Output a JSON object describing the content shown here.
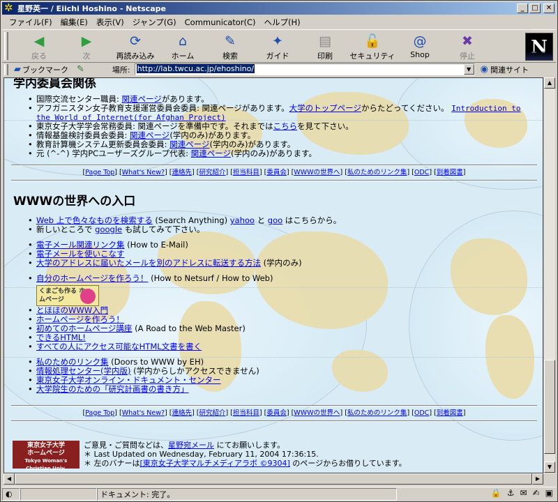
{
  "window": {
    "title": "星野英一 / Eiichi Hoshino - Netscape",
    "controls": {
      "minimize": "_",
      "maximize": "□",
      "close": "✕"
    }
  },
  "menu": [
    "ファイル(F)",
    "編集(E)",
    "表示(V)",
    "ジャンプ(G)",
    "Communicator(C)",
    "ヘルプ(H)"
  ],
  "toolbar": [
    {
      "label": "戻る",
      "icon": "back-arrow-icon",
      "glyph": "◀",
      "disabled": true
    },
    {
      "label": "次",
      "icon": "forward-arrow-icon",
      "glyph": "▶",
      "disabled": true
    },
    {
      "label": "再読み込み",
      "icon": "reload-icon",
      "glyph": "⟳",
      "disabled": false
    },
    {
      "label": "ホーム",
      "icon": "home-icon",
      "glyph": "⌂",
      "disabled": false
    },
    {
      "label": "検索",
      "icon": "search-icon",
      "glyph": "✎",
      "disabled": false
    },
    {
      "label": "ガイド",
      "icon": "guide-icon",
      "glyph": "✦",
      "disabled": false
    },
    {
      "label": "印刷",
      "icon": "print-icon",
      "glyph": "▤",
      "disabled": false
    },
    {
      "label": "セキュリティ",
      "icon": "lock-icon",
      "glyph": "🔓",
      "disabled": false
    },
    {
      "label": "Shop",
      "icon": "shop-icon",
      "glyph": "@",
      "disabled": false
    },
    {
      "label": "停止",
      "icon": "stop-icon",
      "glyph": "✖",
      "disabled": true
    }
  ],
  "brand_letter": "N",
  "location": {
    "bookmark_label": "ブックマーク",
    "location_label": "場所:",
    "url": "http://lab.twcu.ac.jp/ehoshino/",
    "related_label": "関連サイト"
  },
  "content": {
    "section1_title": "学内委員会関係",
    "section1_items": [
      {
        "pre": "国際交流センター職員: ",
        "link": "関連ページ",
        "post": "があります。"
      },
      {
        "pre": "アフガニスタン女子教育支援運営委員会委員: 関連ページがあります。",
        "link": "大学のトップページ",
        "post": "からたどってください。",
        "link2": "Introduction to the World of Internet(for Afghan Project)"
      },
      {
        "pre": "東京女子大学学会常務委員: 関連ページを準備中です。それまでは",
        "link": "こちら",
        "post": "を見て下さい。"
      },
      {
        "pre": "情報基盤検討委員会委員: ",
        "link": "関連ページ",
        "post": "(学内のみ)があります。"
      },
      {
        "pre": "教育計算機システム更新委員会委員: ",
        "link": "関連ページ",
        "post": "(学内のみ)があります。"
      },
      {
        "pre": "元 (^-^) 学内PCユーザーズグループ代表: ",
        "link": "関連ページ",
        "post": "(学内のみ)があります。"
      }
    ],
    "navbar": [
      "Page Top",
      "What's New?",
      "連絡先",
      "研究紹介",
      "担当科目",
      "委員会",
      "WWWの世界へ",
      "私のためのリンク集",
      "ODC",
      "到着図書"
    ],
    "section2_title": "WWWの世界への入口",
    "search_item": {
      "link": "Web 上で色々なものを検索する",
      "post": " (Search Anything) ",
      "link_a": "yahoo",
      "mid": " と ",
      "link_b": "goo",
      "end": " はこちらから。"
    },
    "google_item": {
      "pre": "新しいところで ",
      "link": "google",
      "post": " も試してみて下さい。"
    },
    "mail_items": [
      {
        "link": "電子メール関連リンク集",
        "post": " (How to E-Mail)"
      },
      {
        "link": "電子メールを使いこなす",
        "post": ""
      },
      {
        "link": "大学のアドレスに届いたメールを別のアドレスに転送する方法",
        "post": " (学内のみ)"
      }
    ],
    "homepage_item": {
      "link": "自分のホームページを作ろう！",
      "post": " (How to Netsurf / How to Web)"
    },
    "badge_text": "くまごも作る ホームページ",
    "web_items": [
      "とほほのWWW入門",
      "ホームページを作ろう！",
      "初めてのホームページ講座",
      "できるHTML!",
      "すべての人にアクセス可能なHTML文書を書く"
    ],
    "web_items_suffix": [
      "",
      "",
      " (A Road to the Web Master)",
      "",
      ""
    ],
    "link_items": [
      {
        "link": "私のためのリンク集",
        "post": " (Doors to WWW by EH)"
      },
      {
        "link": "情報処理センター(学内版)",
        "post": " (学内からしかアクセスできません)"
      },
      {
        "link": "東京女子大学オンライン・ドキュメント・センター",
        "post": ""
      },
      {
        "link": "大学院生のための「研究計画書の書き方」",
        "post": ""
      }
    ],
    "footer": {
      "logo_line1": "東京女子大学",
      "logo_line2": "ホームページ",
      "logo_line3": "Tokyo Woman's Christian Univ.",
      "line1_pre": "ご意見・ご質問などは、",
      "line1_link": "星野宛メール",
      "line1_post": " にてお願いします。",
      "line2": "＊ Last Updated on Wednesday, February 11, 2004 17:36:15.",
      "line3_pre": "＊ 左のバナーは",
      "line3_link": "[東京女子大学マルチメディアラボ ©9304]",
      "line3_post": " のページからお借りしています。"
    }
  },
  "status": {
    "text": "ドキュメント: 完了。"
  }
}
